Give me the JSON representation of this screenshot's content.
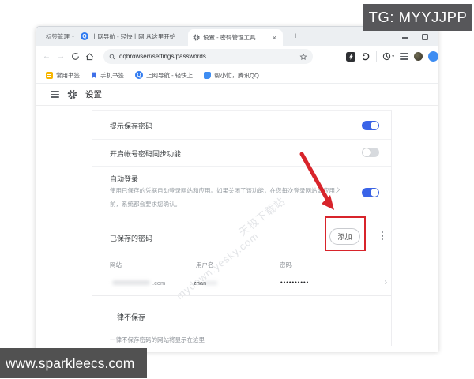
{
  "watermark_top": "TG: MYYJJPP",
  "watermark_bottom": "www.sparkleecs.com",
  "page_watermark": {
    "line1": "天极下载站",
    "line2": "mydown.yesky.com"
  },
  "glyphs": {
    "caret_down": "▾",
    "close": "×",
    "plus": "+",
    "q": "Q",
    "chevron": "›",
    "back": "←",
    "forward": "→"
  },
  "tabstrip": {
    "tab_manager": "标签管理",
    "tab_home": "上网导航 - 轻快上网 从这里开始",
    "tab_settings": "设置 - 密码管理工具"
  },
  "toolbar": {
    "url": "qqbrowser//settings/passwords"
  },
  "bookmarks": {
    "item1": "常用书签",
    "item2": "手机书签",
    "item3": "上网导航 - 轻快上",
    "item4": "帮小忙，腾讯QQ"
  },
  "settings": {
    "title": "设置",
    "save_prompt_label": "提示保存密码",
    "sync_label": "开启帐号密码同步功能",
    "auto_login_title": "自动登录",
    "auto_login_desc_line1": "使用已保存的凭据自动登录网站和应用。如果关闭了该功能，在您每次登录网站或应用之",
    "auto_login_desc_line2": "前，系统都会要求您确认。",
    "saved_passwords_label": "已保存的密码",
    "add_button_label": "添加",
    "table": {
      "col_site": "网站",
      "col_user": "用户名",
      "col_pass": "密码",
      "row_site_suffix": ".com",
      "row_user": "zhan",
      "row_pass_dots": "••••••••••"
    },
    "never_save_label": "一律不保存",
    "never_save_hint": "一律不保存密码的网站将显示在这里"
  },
  "colors": {
    "toggle_on": "#3a64e8",
    "annotation_red": "#d8242b"
  }
}
